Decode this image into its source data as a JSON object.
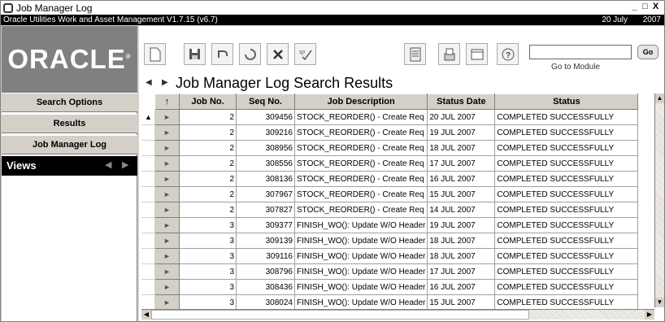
{
  "window": {
    "title": "Job Manager Log",
    "subtitle": "Oracle Utilities Work and Asset Management V1.7.15 (v6.7)",
    "date": "20 July",
    "year": "2007",
    "controls": {
      "minimize": "_",
      "restore": "□",
      "close": "X"
    }
  },
  "logo": {
    "text": "ORACLE",
    "mark": "®"
  },
  "toolbar": {
    "buttons": [
      {
        "name": "new-record-icon",
        "glyph": "🗋"
      },
      {
        "name": "save-icon",
        "glyph": "💾"
      },
      {
        "name": "undo-icon",
        "glyph": "↶"
      },
      {
        "name": "refresh-icon",
        "glyph": "⟳"
      },
      {
        "name": "delete-icon",
        "glyph": "✕"
      },
      {
        "name": "spellcheck-icon",
        "glyph": "✓"
      },
      {
        "name": "report-icon",
        "glyph": "▤"
      },
      {
        "name": "print-icon",
        "glyph": "⎙"
      },
      {
        "name": "window-icon",
        "glyph": "▭"
      },
      {
        "name": "help-icon",
        "glyph": "?"
      }
    ],
    "go_to_module": {
      "value": "",
      "label": "Go to Module",
      "go": "Go"
    }
  },
  "page": {
    "title": "Job Manager Log Search Results",
    "nav_back": "◀",
    "nav_forward": "▶"
  },
  "leftnav": {
    "items": [
      "Search Options",
      "Results",
      "Job Manager Log"
    ],
    "views_label": "Views",
    "views_prev": "◀",
    "views_next": "▶"
  },
  "grid": {
    "columns": [
      "Job No.",
      "Seq No.",
      "Job Description",
      "Status Date",
      "Status"
    ],
    "sort_marker": "↑",
    "rows": [
      {
        "job": "2",
        "seq": "309456",
        "desc": "STOCK_REORDER() - Create Req",
        "date": "20 JUL 2007",
        "status": "COMPLETED SUCCESSFULLY"
      },
      {
        "job": "2",
        "seq": "309216",
        "desc": "STOCK_REORDER() - Create Req",
        "date": "19 JUL 2007",
        "status": "COMPLETED SUCCESSFULLY"
      },
      {
        "job": "2",
        "seq": "308956",
        "desc": "STOCK_REORDER() - Create Req",
        "date": "18 JUL 2007",
        "status": "COMPLETED SUCCESSFULLY"
      },
      {
        "job": "2",
        "seq": "308556",
        "desc": "STOCK_REORDER() - Create Req",
        "date": "17 JUL 2007",
        "status": "COMPLETED SUCCESSFULLY"
      },
      {
        "job": "2",
        "seq": "308136",
        "desc": "STOCK_REORDER() - Create Req",
        "date": "16 JUL 2007",
        "status": "COMPLETED SUCCESSFULLY"
      },
      {
        "job": "2",
        "seq": "307967",
        "desc": "STOCK_REORDER() - Create Req",
        "date": "15 JUL 2007",
        "status": "COMPLETED SUCCESSFULLY"
      },
      {
        "job": "2",
        "seq": "307827",
        "desc": "STOCK_REORDER() - Create Req",
        "date": "14 JUL 2007",
        "status": "COMPLETED SUCCESSFULLY"
      },
      {
        "job": "3",
        "seq": "309377",
        "desc": "FINISH_WO(): Update W/O Header",
        "date": "19 JUL 2007",
        "status": "COMPLETED SUCCESSFULLY"
      },
      {
        "job": "3",
        "seq": "309139",
        "desc": "FINISH_WO(): Update W/O Header",
        "date": "18 JUL 2007",
        "status": "COMPLETED SUCCESSFULLY"
      },
      {
        "job": "3",
        "seq": "309116",
        "desc": "FINISH_WO(): Update W/O Header",
        "date": "18 JUL 2007",
        "status": "COMPLETED SUCCESSFULLY"
      },
      {
        "job": "3",
        "seq": "308796",
        "desc": "FINISH_WO(): Update W/O Header",
        "date": "17 JUL 2007",
        "status": "COMPLETED SUCCESSFULLY"
      },
      {
        "job": "3",
        "seq": "308436",
        "desc": "FINISH_WO(): Update W/O Header",
        "date": "16 JUL 2007",
        "status": "COMPLETED SUCCESSFULLY"
      },
      {
        "job": "3",
        "seq": "308024",
        "desc": "FINISH_WO(): Update W/O Header",
        "date": "15 JUL 2007",
        "status": "COMPLETED SUCCESSFULLY"
      }
    ],
    "current_row_marker": "▲",
    "row_selector": "►"
  },
  "colors": {
    "chrome": "#d4d0c8",
    "logo_bg": "#808080",
    "subbar_bg": "#000000"
  }
}
